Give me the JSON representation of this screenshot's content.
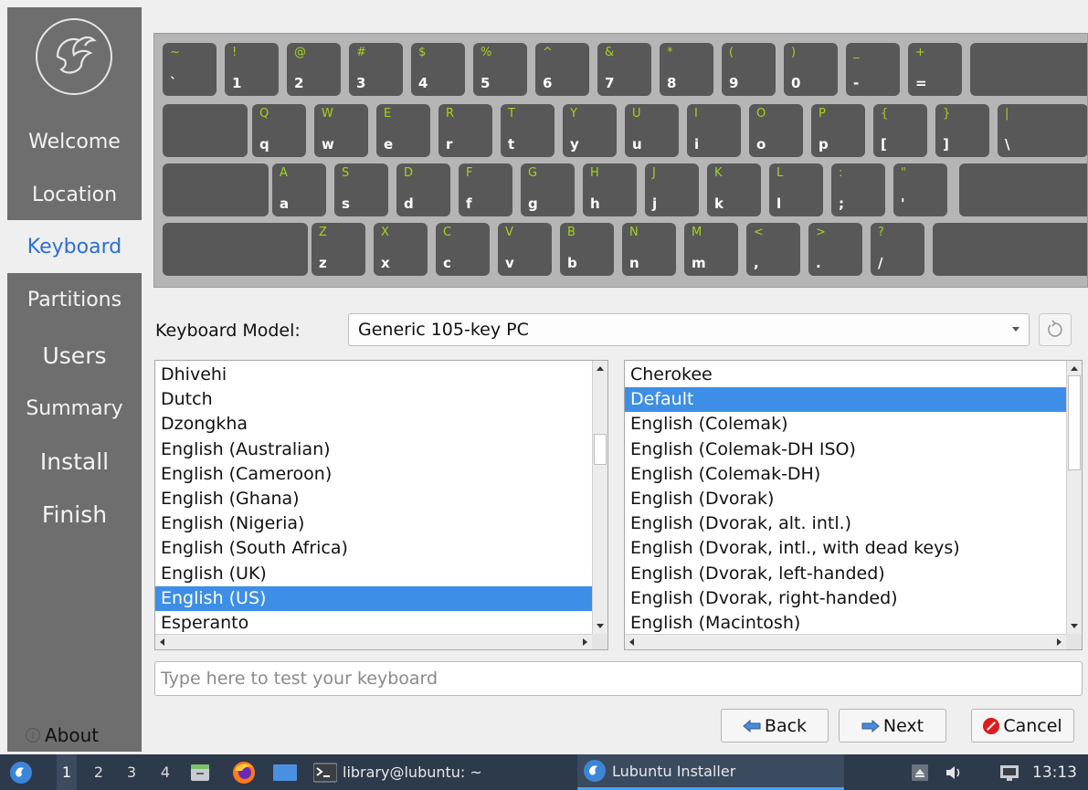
{
  "sidebar": {
    "logo_icon": "lubuntu-bird-icon",
    "items": [
      {
        "label": "Welcome"
      },
      {
        "label": "Location"
      },
      {
        "label": "Keyboard"
      },
      {
        "label": "Partitions"
      },
      {
        "label": "Users"
      },
      {
        "label": "Summary"
      },
      {
        "label": "Install"
      },
      {
        "label": "Finish"
      }
    ],
    "active_item": "Keyboard",
    "about_label": "About"
  },
  "keyboard_preview": {
    "rows": [
      [
        {
          "shift": "~",
          "main": "`"
        },
        {
          "shift": "!",
          "main": "1"
        },
        {
          "shift": "@",
          "main": "2"
        },
        {
          "shift": "#",
          "main": "3"
        },
        {
          "shift": "$",
          "main": "4"
        },
        {
          "shift": "%",
          "main": "5"
        },
        {
          "shift": "^",
          "main": "6"
        },
        {
          "shift": "&",
          "main": "7"
        },
        {
          "shift": "*",
          "main": "8"
        },
        {
          "shift": "(",
          "main": "9"
        },
        {
          "shift": ")",
          "main": "0"
        },
        {
          "shift": "_",
          "main": "-"
        },
        {
          "shift": "+",
          "main": "="
        },
        {
          "shift": "",
          "main": ""
        }
      ],
      [
        {
          "shift": "",
          "main": ""
        },
        {
          "shift": "Q",
          "main": "q"
        },
        {
          "shift": "W",
          "main": "w"
        },
        {
          "shift": "E",
          "main": "e"
        },
        {
          "shift": "R",
          "main": "r"
        },
        {
          "shift": "T",
          "main": "t"
        },
        {
          "shift": "Y",
          "main": "y"
        },
        {
          "shift": "U",
          "main": "u"
        },
        {
          "shift": "I",
          "main": "i"
        },
        {
          "shift": "O",
          "main": "o"
        },
        {
          "shift": "P",
          "main": "p"
        },
        {
          "shift": "{",
          "main": "["
        },
        {
          "shift": "}",
          "main": "]"
        },
        {
          "shift": "|",
          "main": "\\"
        }
      ],
      [
        {
          "shift": "",
          "main": ""
        },
        {
          "shift": "A",
          "main": "a"
        },
        {
          "shift": "S",
          "main": "s"
        },
        {
          "shift": "D",
          "main": "d"
        },
        {
          "shift": "F",
          "main": "f"
        },
        {
          "shift": "G",
          "main": "g"
        },
        {
          "shift": "H",
          "main": "h"
        },
        {
          "shift": "J",
          "main": "j"
        },
        {
          "shift": "K",
          "main": "k"
        },
        {
          "shift": "L",
          "main": "l"
        },
        {
          "shift": ":",
          "main": ";"
        },
        {
          "shift": "\"",
          "main": "'"
        },
        {
          "shift": "",
          "main": ""
        }
      ],
      [
        {
          "shift": "",
          "main": ""
        },
        {
          "shift": "Z",
          "main": "z"
        },
        {
          "shift": "X",
          "main": "x"
        },
        {
          "shift": "C",
          "main": "c"
        },
        {
          "shift": "V",
          "main": "v"
        },
        {
          "shift": "B",
          "main": "b"
        },
        {
          "shift": "N",
          "main": "n"
        },
        {
          "shift": "M",
          "main": "m"
        },
        {
          "shift": "<",
          "main": ","
        },
        {
          "shift": ">",
          "main": "."
        },
        {
          "shift": "?",
          "main": "/"
        },
        {
          "shift": "",
          "main": ""
        }
      ]
    ]
  },
  "model": {
    "label": "Keyboard Model:",
    "value": "Generic 105-key PC",
    "reset_icon": "reset-icon"
  },
  "layouts": {
    "items": [
      "Dhivehi",
      "Dutch",
      "Dzongkha",
      "English (Australian)",
      "English (Cameroon)",
      "English (Ghana)",
      "English (Nigeria)",
      "English (South Africa)",
      "English (UK)",
      "English (US)",
      "Esperanto"
    ],
    "selected": "English (US)"
  },
  "variants": {
    "items": [
      "Cherokee",
      "Default",
      "English (Colemak)",
      "English (Colemak-DH ISO)",
      "English (Colemak-DH)",
      "English (Dvorak)",
      "English (Dvorak, alt. intl.)",
      "English (Dvorak, intl., with dead keys)",
      "English (Dvorak, left-handed)",
      "English (Dvorak, right-handed)",
      "English (Macintosh)"
    ],
    "selected": "Default"
  },
  "test_input": {
    "placeholder": "Type here to test your keyboard",
    "value": ""
  },
  "buttons": {
    "back": "Back",
    "next": "Next",
    "cancel": "Cancel"
  },
  "taskbar": {
    "workspaces": [
      "1",
      "2",
      "3",
      "4"
    ],
    "active_workspace": "1",
    "terminal_task": "library@lubuntu: ~",
    "installer_task": "Lubuntu Installer",
    "clock": "13:13"
  },
  "colors": {
    "sidebar_bg": "#6e6e6e",
    "accent": "#3d8ee6",
    "key_bg": "#585858",
    "key_shift_label": "#a4d21c",
    "taskbar_bg": "#2d3a4b"
  }
}
